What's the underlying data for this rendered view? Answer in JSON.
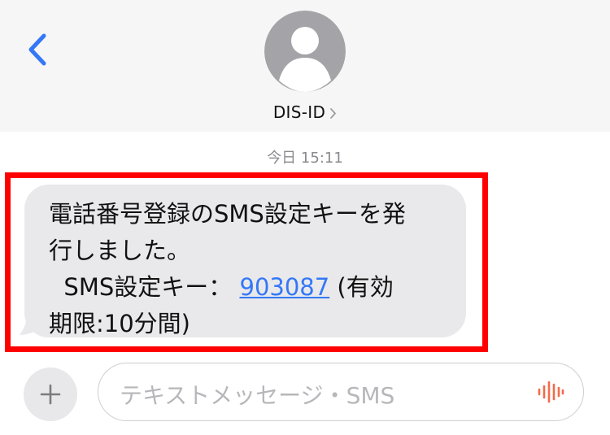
{
  "header": {
    "contact_name": "DIS-ID"
  },
  "conversation": {
    "timestamp": "今日 15:11",
    "message": {
      "line1": "電話番号登録のSMS設定キーを発",
      "line2": "行しました。",
      "line3_prefix": "  SMS設定キー： ",
      "code": "903087",
      "line3_suffix": " (有効",
      "line4": "期限:10分間)"
    }
  },
  "composer": {
    "placeholder": "テキストメッセージ・SMS"
  },
  "colors": {
    "accent": "#3478f6",
    "bubble": "#e9e9eb",
    "highlight": "#ff0000",
    "mic": "#f26b4b"
  },
  "icons": {
    "back": "chevron-left-icon",
    "avatar": "person-icon",
    "contact_chevron": "chevron-right-icon",
    "add": "plus-icon",
    "audio": "waveform-icon"
  }
}
